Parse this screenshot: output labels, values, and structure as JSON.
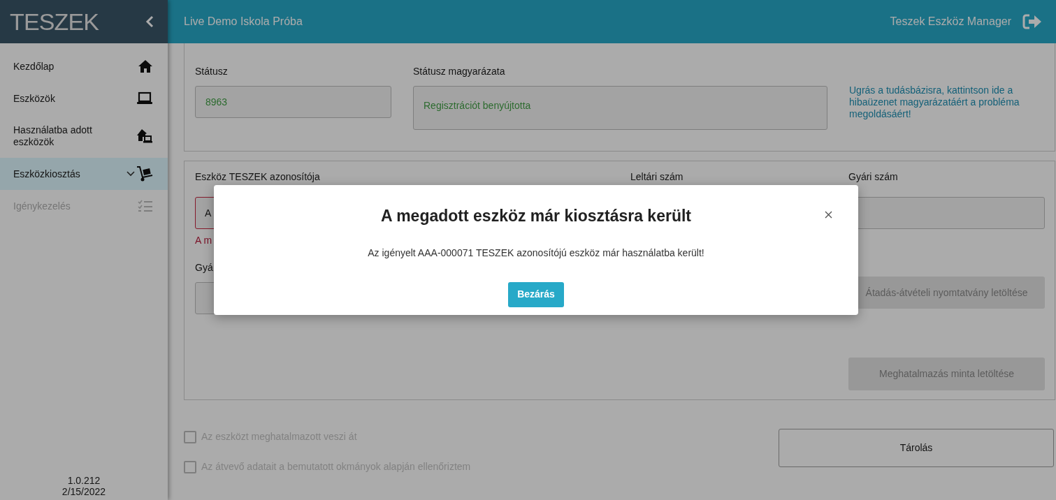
{
  "sidebar": {
    "brand": "TESZEK",
    "items": [
      {
        "label": "Kezdőlap",
        "selected": false,
        "disabled": false,
        "submenu": false
      },
      {
        "label": "Eszközök",
        "selected": false,
        "disabled": false,
        "submenu": false
      },
      {
        "label": "Használatba adott eszközök",
        "selected": false,
        "disabled": false,
        "submenu": false
      },
      {
        "label": "Eszközkiosztás",
        "selected": true,
        "disabled": false,
        "submenu": true
      },
      {
        "label": "Igénykezelés",
        "selected": false,
        "disabled": true,
        "submenu": false
      }
    ],
    "version": "1.0.212",
    "date": "2/15/2022"
  },
  "header": {
    "title": "Live Demo Iskola Próba",
    "app_name": "Teszek Eszköz Manager"
  },
  "status_card": {
    "status_label": "Státusz",
    "status_value": "8963",
    "explanation_label": "Státusz magyarázata",
    "explanation_value": "Regisztrációt benyújtotta",
    "help_link": "Ugrás a tudásbázisra, kattintson ide a hibaüzenet magyarázatáért a probléma megoldásáért!"
  },
  "assign_card": {
    "id_label": "Eszköz TESZEK azonosítója",
    "id_value": "A",
    "id_invalid": true,
    "id_error": "A m",
    "inventory_label": "Leltári szám",
    "serial_label": "Gyári szám",
    "second_label": "Gyá",
    "handover_button": {
      "label": "Átadás-átvételi nyomtatvány letöltése",
      "disabled": true
    },
    "proxy_button": {
      "label": "Meghatalmazás minta letöltése",
      "disabled": true
    }
  },
  "checkboxes": [
    {
      "label": "Az eszközt meghatalmazott veszi át",
      "checked": false
    },
    {
      "label": "Az átvevő adatait a bemutatott okmányok alapján ellenőriztem",
      "checked": false
    }
  ],
  "save_button": "Tárolás",
  "modal": {
    "title": "A megadott eszköz már kiosztásra került",
    "message": "Az igényelt AAA-000071 TESZEK azonosítójú eszköz már használatba került!",
    "button": "Bezárás"
  }
}
